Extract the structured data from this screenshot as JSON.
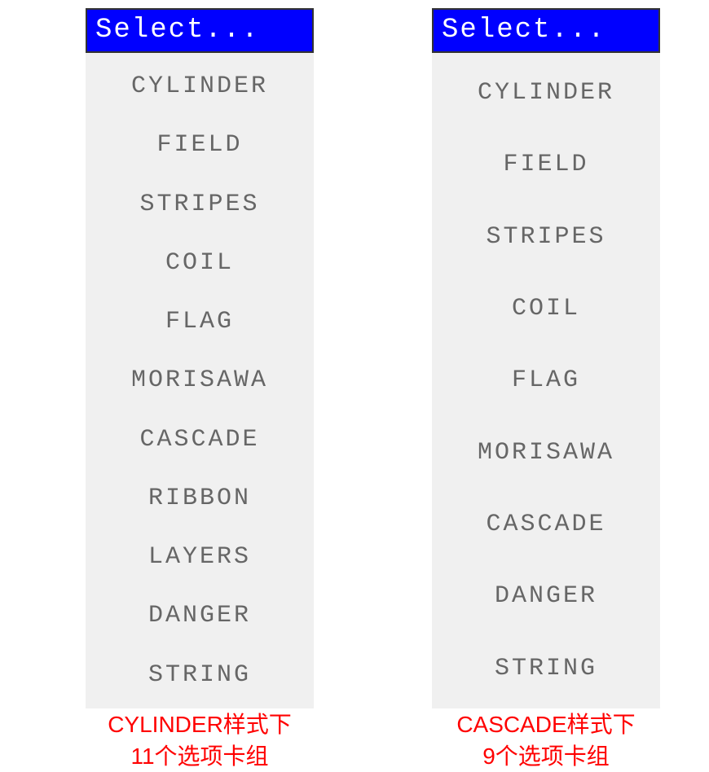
{
  "left": {
    "header": "Select...",
    "options": [
      "CYLINDER",
      "FIELD",
      "STRIPES",
      "COIL",
      "FLAG",
      "MORISAWA",
      "CASCADE",
      "RIBBON",
      "LAYERS",
      "DANGER",
      "STRING"
    ],
    "caption_line1": "CYLINDER样式下",
    "caption_line2": "11个选项卡组"
  },
  "right": {
    "header": "Select...",
    "options": [
      "CYLINDER",
      "FIELD",
      "STRIPES",
      "COIL",
      "FLAG",
      "MORISAWA",
      "CASCADE",
      "DANGER",
      "STRING"
    ],
    "caption_line1": "CASCADE样式下",
    "caption_line2": "9个选项卡组"
  }
}
